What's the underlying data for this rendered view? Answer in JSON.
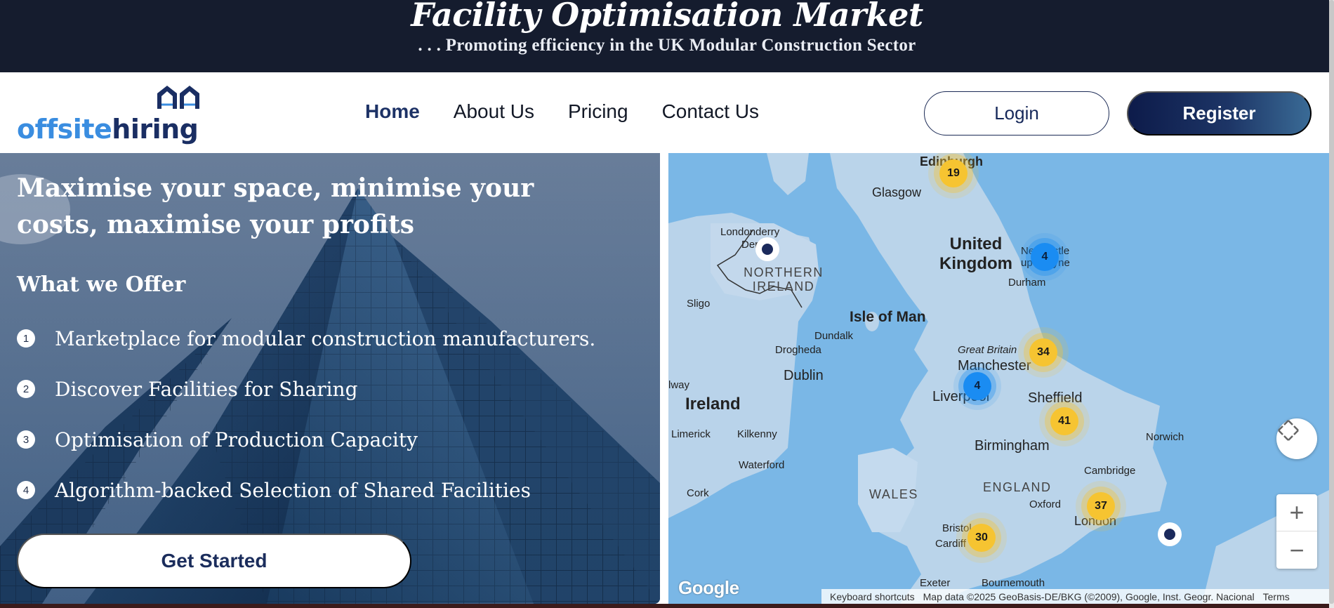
{
  "banner": {
    "title": "Facility Optimisation Market",
    "subtitle": ". . . Promoting efficiency in the UK Modular Construction Sector"
  },
  "logo": {
    "part1": "offsite",
    "part2": "hiring"
  },
  "nav": {
    "links": [
      "Home",
      "About Us",
      "Pricing",
      "Contact Us"
    ],
    "active": "Home",
    "login_label": "Login",
    "register_label": "Register"
  },
  "hero": {
    "heading": "Maximise your space, minimise your costs, maximise your profits",
    "subheading": "What we Offer",
    "offers": [
      {
        "num": "1",
        "text": "Marketplace for modular construction manufacturers."
      },
      {
        "num": "2",
        "text": "Discover Facilities for Sharing"
      },
      {
        "num": "3",
        "text": "Optimisation of Production Capacity"
      },
      {
        "num": "4",
        "text": "Algorithm-backed Selection of Shared Facilities"
      }
    ],
    "cta_label": "Get Started"
  },
  "map": {
    "places": {
      "edinburgh": "Edinburgh",
      "glasgow": "Glasgow",
      "londonderry": "Londonderry",
      "derry": "Derry",
      "northern_ireland": "NORTHERN IRELAND",
      "united_kingdom": "United Kingdom",
      "newcastle": "Newcastle upon Tyne",
      "durham": "Durham",
      "sligo": "Sligo",
      "isle_of_man": "Isle of Man",
      "dundalk": "Dundalk",
      "drogheda": "Drogheda",
      "great_britain": "Great Britain",
      "manchester": "Manchester",
      "dublin": "Dublin",
      "ireland": "Ireland",
      "liverpool": "Liverpool",
      "sheffield": "Sheffield",
      "limerick": "Limerick",
      "kilkenny": "Kilkenny",
      "birmingham": "Birmingham",
      "norwich": "Norwich",
      "waterford": "Waterford",
      "cambridge": "Cambridge",
      "cork": "Cork",
      "wales": "WALES",
      "england": "ENGLAND",
      "oxford": "Oxford",
      "london": "London",
      "bristol": "Bristol",
      "cardiff": "Cardiff",
      "exeter": "Exeter",
      "bournemouth": "Bournemouth",
      "galway_partial": "lway"
    },
    "clusters": [
      {
        "count": "19",
        "color": "yellow"
      },
      {
        "count": "4",
        "color": "blue"
      },
      {
        "count": "34",
        "color": "yellow"
      },
      {
        "count": "4",
        "color": "blue"
      },
      {
        "count": "41",
        "color": "yellow"
      },
      {
        "count": "37",
        "color": "yellow"
      },
      {
        "count": "30",
        "color": "yellow"
      }
    ],
    "zoom_in": "+",
    "zoom_out": "−",
    "google_logo": "Google",
    "footer": {
      "shortcuts": "Keyboard shortcuts",
      "attribution": "Map data ©2025 GeoBasis-DE/BKG (©2009), Google, Inst. Geogr. Nacional",
      "terms": "Terms"
    }
  },
  "colors": {
    "banner_bg": "#151c2e",
    "brand_dark": "#1a2e63",
    "brand_light": "#3a8de0",
    "cluster_yellow": "#f6c431",
    "cluster_blue": "#1a8cf2",
    "map_water": "#7ab7e6"
  }
}
